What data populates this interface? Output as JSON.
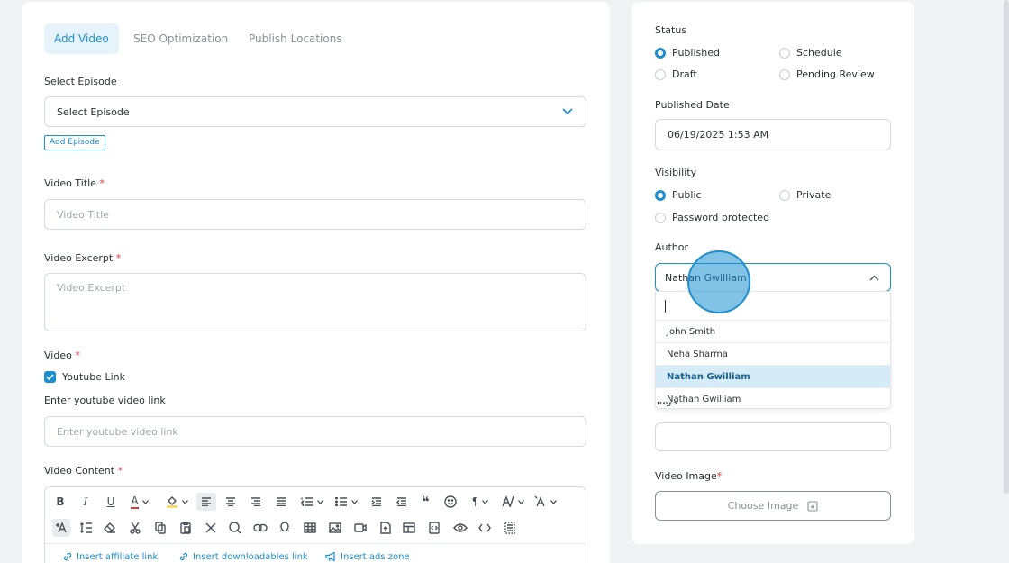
{
  "tabs": [
    {
      "label": "Add Video"
    },
    {
      "label": "SEO Optimization"
    },
    {
      "label": "Publish Locations"
    }
  ],
  "episode": {
    "label": "Select Episode",
    "value": "Select Episode",
    "add_button": "Add Episode"
  },
  "video_title": {
    "label": "Video Title",
    "required": "*",
    "placeholder": "Video Title"
  },
  "video_excerpt": {
    "label": "Video Excerpt",
    "required": "*",
    "placeholder": "Video Excerpt"
  },
  "video": {
    "label": "Video",
    "required": "*",
    "youtube_checkbox": "Youtube Link",
    "youtube_label": "Enter youtube video link",
    "youtube_placeholder": "Enter youtube video link"
  },
  "video_content": {
    "label": "Video Content",
    "required": "*",
    "toolbar": {
      "bold": "B",
      "italic": "I",
      "underline": "U",
      "font_color": "A",
      "paragraph": "¶",
      "insert_links": [
        {
          "label": "Insert affiliate link"
        },
        {
          "label": "Insert downloadables link"
        },
        {
          "label": "Insert ads zone"
        }
      ]
    }
  },
  "status": {
    "label": "Status",
    "options": [
      {
        "label": "Published",
        "checked": true
      },
      {
        "label": "Schedule",
        "checked": false
      },
      {
        "label": "Draft",
        "checked": false
      },
      {
        "label": "Pending Review",
        "checked": false
      }
    ]
  },
  "published_date": {
    "label": "Published Date",
    "value": "06/19/2025 1:53 AM"
  },
  "visibility": {
    "label": "Visibility",
    "options": [
      {
        "label": "Public",
        "checked": true
      },
      {
        "label": "Private",
        "checked": false
      },
      {
        "label": "Password protected",
        "checked": false
      }
    ]
  },
  "author": {
    "label": "Author",
    "value": "Nathan Gwilliam",
    "search_value": "",
    "options": [
      {
        "label": "John Smith",
        "selected": false
      },
      {
        "label": "Neha Sharma",
        "selected": false
      },
      {
        "label": "Nathan Gwilliam",
        "selected": true
      },
      {
        "label": "Nathan Gwilliam",
        "selected": false
      }
    ]
  },
  "tags": {
    "label": "Tags"
  },
  "video_image": {
    "label": "Video Image",
    "required": "*",
    "button": "Choose Image"
  },
  "colors": {
    "accent": "#1b8fcf",
    "required": "#e0353b",
    "selected_bg": "#d6ebf8"
  }
}
